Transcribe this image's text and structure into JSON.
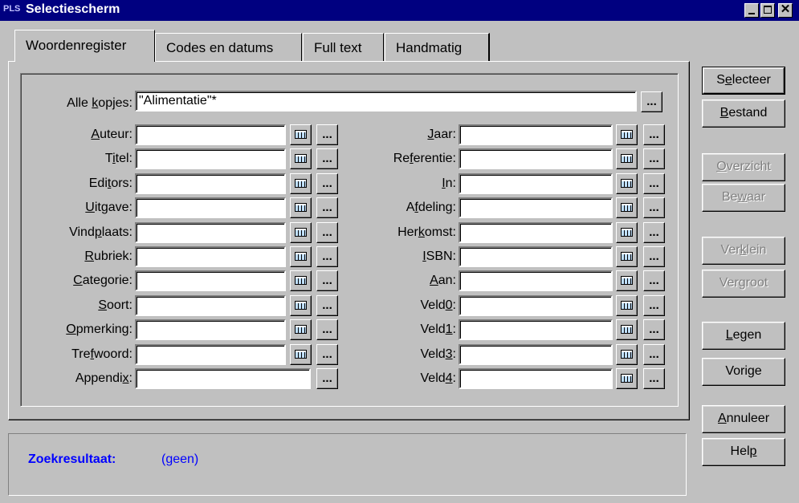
{
  "window": {
    "icon_text": "PLS",
    "title": "Selectiescherm",
    "colors": {
      "titlebar": "#000080",
      "result_text": "#0000ff",
      "face": "#c0c0c0"
    }
  },
  "tabs": [
    {
      "label": "Woordenregister",
      "active": true
    },
    {
      "label": "Codes en datums",
      "active": false
    },
    {
      "label": "Full text",
      "active": false
    },
    {
      "label": "Handmatig",
      "active": false
    }
  ],
  "search": {
    "alle_kopjes_label": "Alle kopjes:",
    "alle_kopjes_value": "\"Alimentatie\"*",
    "browse_label": "..."
  },
  "fields_left": [
    {
      "label": "Auteur:",
      "value": "",
      "has_list": true
    },
    {
      "label": "Titel:",
      "value": "",
      "has_list": true
    },
    {
      "label": "Editors:",
      "value": "",
      "has_list": true
    },
    {
      "label": "Uitgave:",
      "value": "",
      "has_list": true
    },
    {
      "label": "Vindplaats:",
      "value": "",
      "has_list": true
    },
    {
      "label": "Rubriek:",
      "value": "",
      "has_list": true
    },
    {
      "label": "Categorie:",
      "value": "",
      "has_list": true
    },
    {
      "label": "Soort:",
      "value": "",
      "has_list": true
    },
    {
      "label": "Opmerking:",
      "value": "",
      "has_list": true
    },
    {
      "label": "Trefwoord:",
      "value": "",
      "has_list": true
    },
    {
      "label": "Appendix:",
      "value": "",
      "has_list": false
    }
  ],
  "fields_right": [
    {
      "label": "Jaar:",
      "value": "",
      "has_list": true
    },
    {
      "label": "Referentie:",
      "value": "",
      "has_list": true
    },
    {
      "label": "In:",
      "value": "",
      "has_list": true
    },
    {
      "label": "Afdeling:",
      "value": "",
      "has_list": true
    },
    {
      "label": "Herkomst:",
      "value": "",
      "has_list": true
    },
    {
      "label": "ISBN:",
      "value": "",
      "has_list": true
    },
    {
      "label": "Aan:",
      "value": "",
      "has_list": true
    },
    {
      "label": "Veld0:",
      "value": "",
      "has_list": true
    },
    {
      "label": "Veld1:",
      "value": "",
      "has_list": true
    },
    {
      "label": "Veld3:",
      "value": "",
      "has_list": true
    },
    {
      "label": "Veld4:",
      "value": "",
      "has_list": true
    }
  ],
  "buttons": {
    "selecteer": "Selecteer",
    "bestand": "Bestand",
    "overzicht": "Overzicht",
    "bewaar": "Bewaar",
    "verklein": "Verklein",
    "vergroot": "Vergroot",
    "legen": "Legen",
    "vorige": "Vorige",
    "annuleer": "Annuleer",
    "help": "Help"
  },
  "result": {
    "label": "Zoekresultaat:",
    "value": "(geen)"
  }
}
